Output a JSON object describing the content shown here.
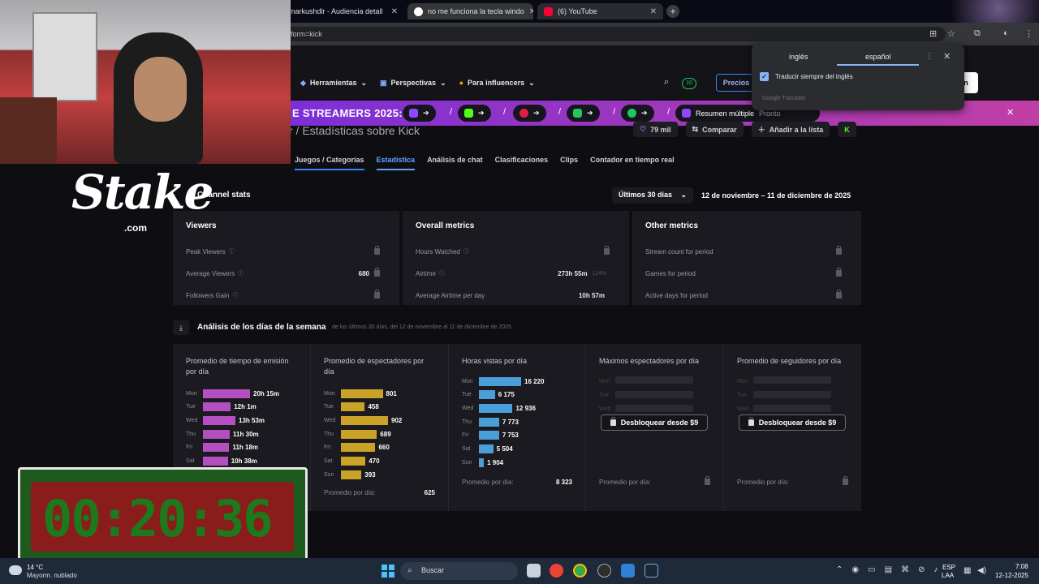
{
  "browser": {
    "tabs": [
      {
        "title": "markushdlr - Audiencia detall"
      },
      {
        "title": "no me funciona la tecla windo"
      },
      {
        "title": "(6) YouTube"
      }
    ],
    "url": "form=kick"
  },
  "translate": {
    "lang_source": "inglés",
    "lang_target": "español",
    "always_translate_label": "Traducir siempre del inglés",
    "provider": "Google Translate"
  },
  "site": {
    "nav": [
      {
        "label": "Herramientas"
      },
      {
        "label": "Perspectivas"
      },
      {
        "label": "Para influencers"
      }
    ],
    "prices_label": "Precios",
    "login_label": "n",
    "banner": {
      "title": "E STREAMERS 2025:",
      "resumen": "Resumen múltiple",
      "pronto": "Pronto"
    },
    "channel_title": "r  / Estadísticas sobre Kick",
    "followers": "79 mil",
    "compare_label": "Comparar",
    "add_list_label": "Añadir a la lista",
    "subtabs": [
      "Juegos / Categorías",
      "Estadística",
      "Análisis de chat",
      "Clasificaciones",
      "Clips",
      "Contador en tiempo real"
    ],
    "active_subtab": "Estadística"
  },
  "stats": {
    "section_title": "Channel stats",
    "period": "Últimos 30 días",
    "date_range": "12 de noviembre – 11 de diciembre de 2025",
    "cards": [
      {
        "title": "Viewers",
        "rows": [
          {
            "label": "Peak Viewers",
            "value": ""
          },
          {
            "label": "Average Viewers",
            "value": "680"
          },
          {
            "label": "Followers Gain",
            "value": ""
          }
        ]
      },
      {
        "title": "Overall metrics",
        "rows": [
          {
            "label": "Hours Watched",
            "value": ""
          },
          {
            "label": "Airtime",
            "value": "273h 55m",
            "extra": "114%"
          },
          {
            "label": "Average Airtime per day",
            "value": "10h 57m"
          }
        ]
      },
      {
        "title": "Other metrics",
        "rows": [
          {
            "label": "Stream count for period",
            "value": ""
          },
          {
            "label": "Games for period",
            "value": ""
          },
          {
            "label": "Active days for period",
            "value": ""
          }
        ]
      }
    ]
  },
  "weekday": {
    "title": "Análisis de los días de la semana",
    "subtitle": "de los últimos 30 días, del 12 de noviembre al 11 de diciembre de 2025",
    "avg_label": "Promedio por día:",
    "unlock_label": "Desbloquear desde $9",
    "columns": [
      {
        "title": "Promedio de tiempo de emisión por día",
        "color": "#b44fc2",
        "days": [
          "Mon",
          "Tue",
          "Wed",
          "Thu",
          "Fri",
          "Sat"
        ],
        "labels": [
          "20h 15m",
          "12h 1m",
          "13h 53m",
          "11h 30m",
          "11h 18m",
          "10h 38m"
        ],
        "fraction": [
          1.0,
          0.59,
          0.69,
          0.57,
          0.56,
          0.53
        ]
      },
      {
        "title": "Promedio de espectadores por día",
        "color": "#c9a227",
        "days": [
          "Mon",
          "Tue",
          "Wed",
          "Thu",
          "Fri",
          "Sat",
          "Sun"
        ],
        "labels": [
          "801",
          "458",
          "902",
          "689",
          "660",
          "470",
          "393"
        ],
        "values": [
          801,
          458,
          902,
          689,
          660,
          470,
          393
        ],
        "avg": "625"
      },
      {
        "title": "Horas vistas por día",
        "color": "#4a9fd8",
        "days": [
          "Mon",
          "Tue",
          "Wed",
          "Thu",
          "Fri",
          "Sat",
          "Sun"
        ],
        "labels": [
          "16 220",
          "6 175",
          "12 936",
          "7 773",
          "7 753",
          "5 504",
          "1 904"
        ],
        "values": [
          16220,
          6175,
          12936,
          7773,
          7753,
          5504,
          1904
        ],
        "avg": "8 323"
      },
      {
        "title": "Máximos espectadores por día",
        "locked": true,
        "days": [
          "Mon",
          "Tue",
          "Wed"
        ]
      },
      {
        "title": "Promedio de seguidores por día",
        "locked": true,
        "days": [
          "Mon",
          "Tue",
          "Wed"
        ]
      }
    ]
  },
  "overlay": {
    "logo": "Stake",
    "logo_sub": ".com",
    "timer": "00:20:36"
  },
  "taskbar": {
    "weather_temp": "14 °C",
    "weather_desc": "Mayorm. nublado",
    "search_label": "Buscar",
    "lang1": "ESP",
    "lang2": "LAA",
    "time": "7:08",
    "date": "12-12-2025"
  }
}
